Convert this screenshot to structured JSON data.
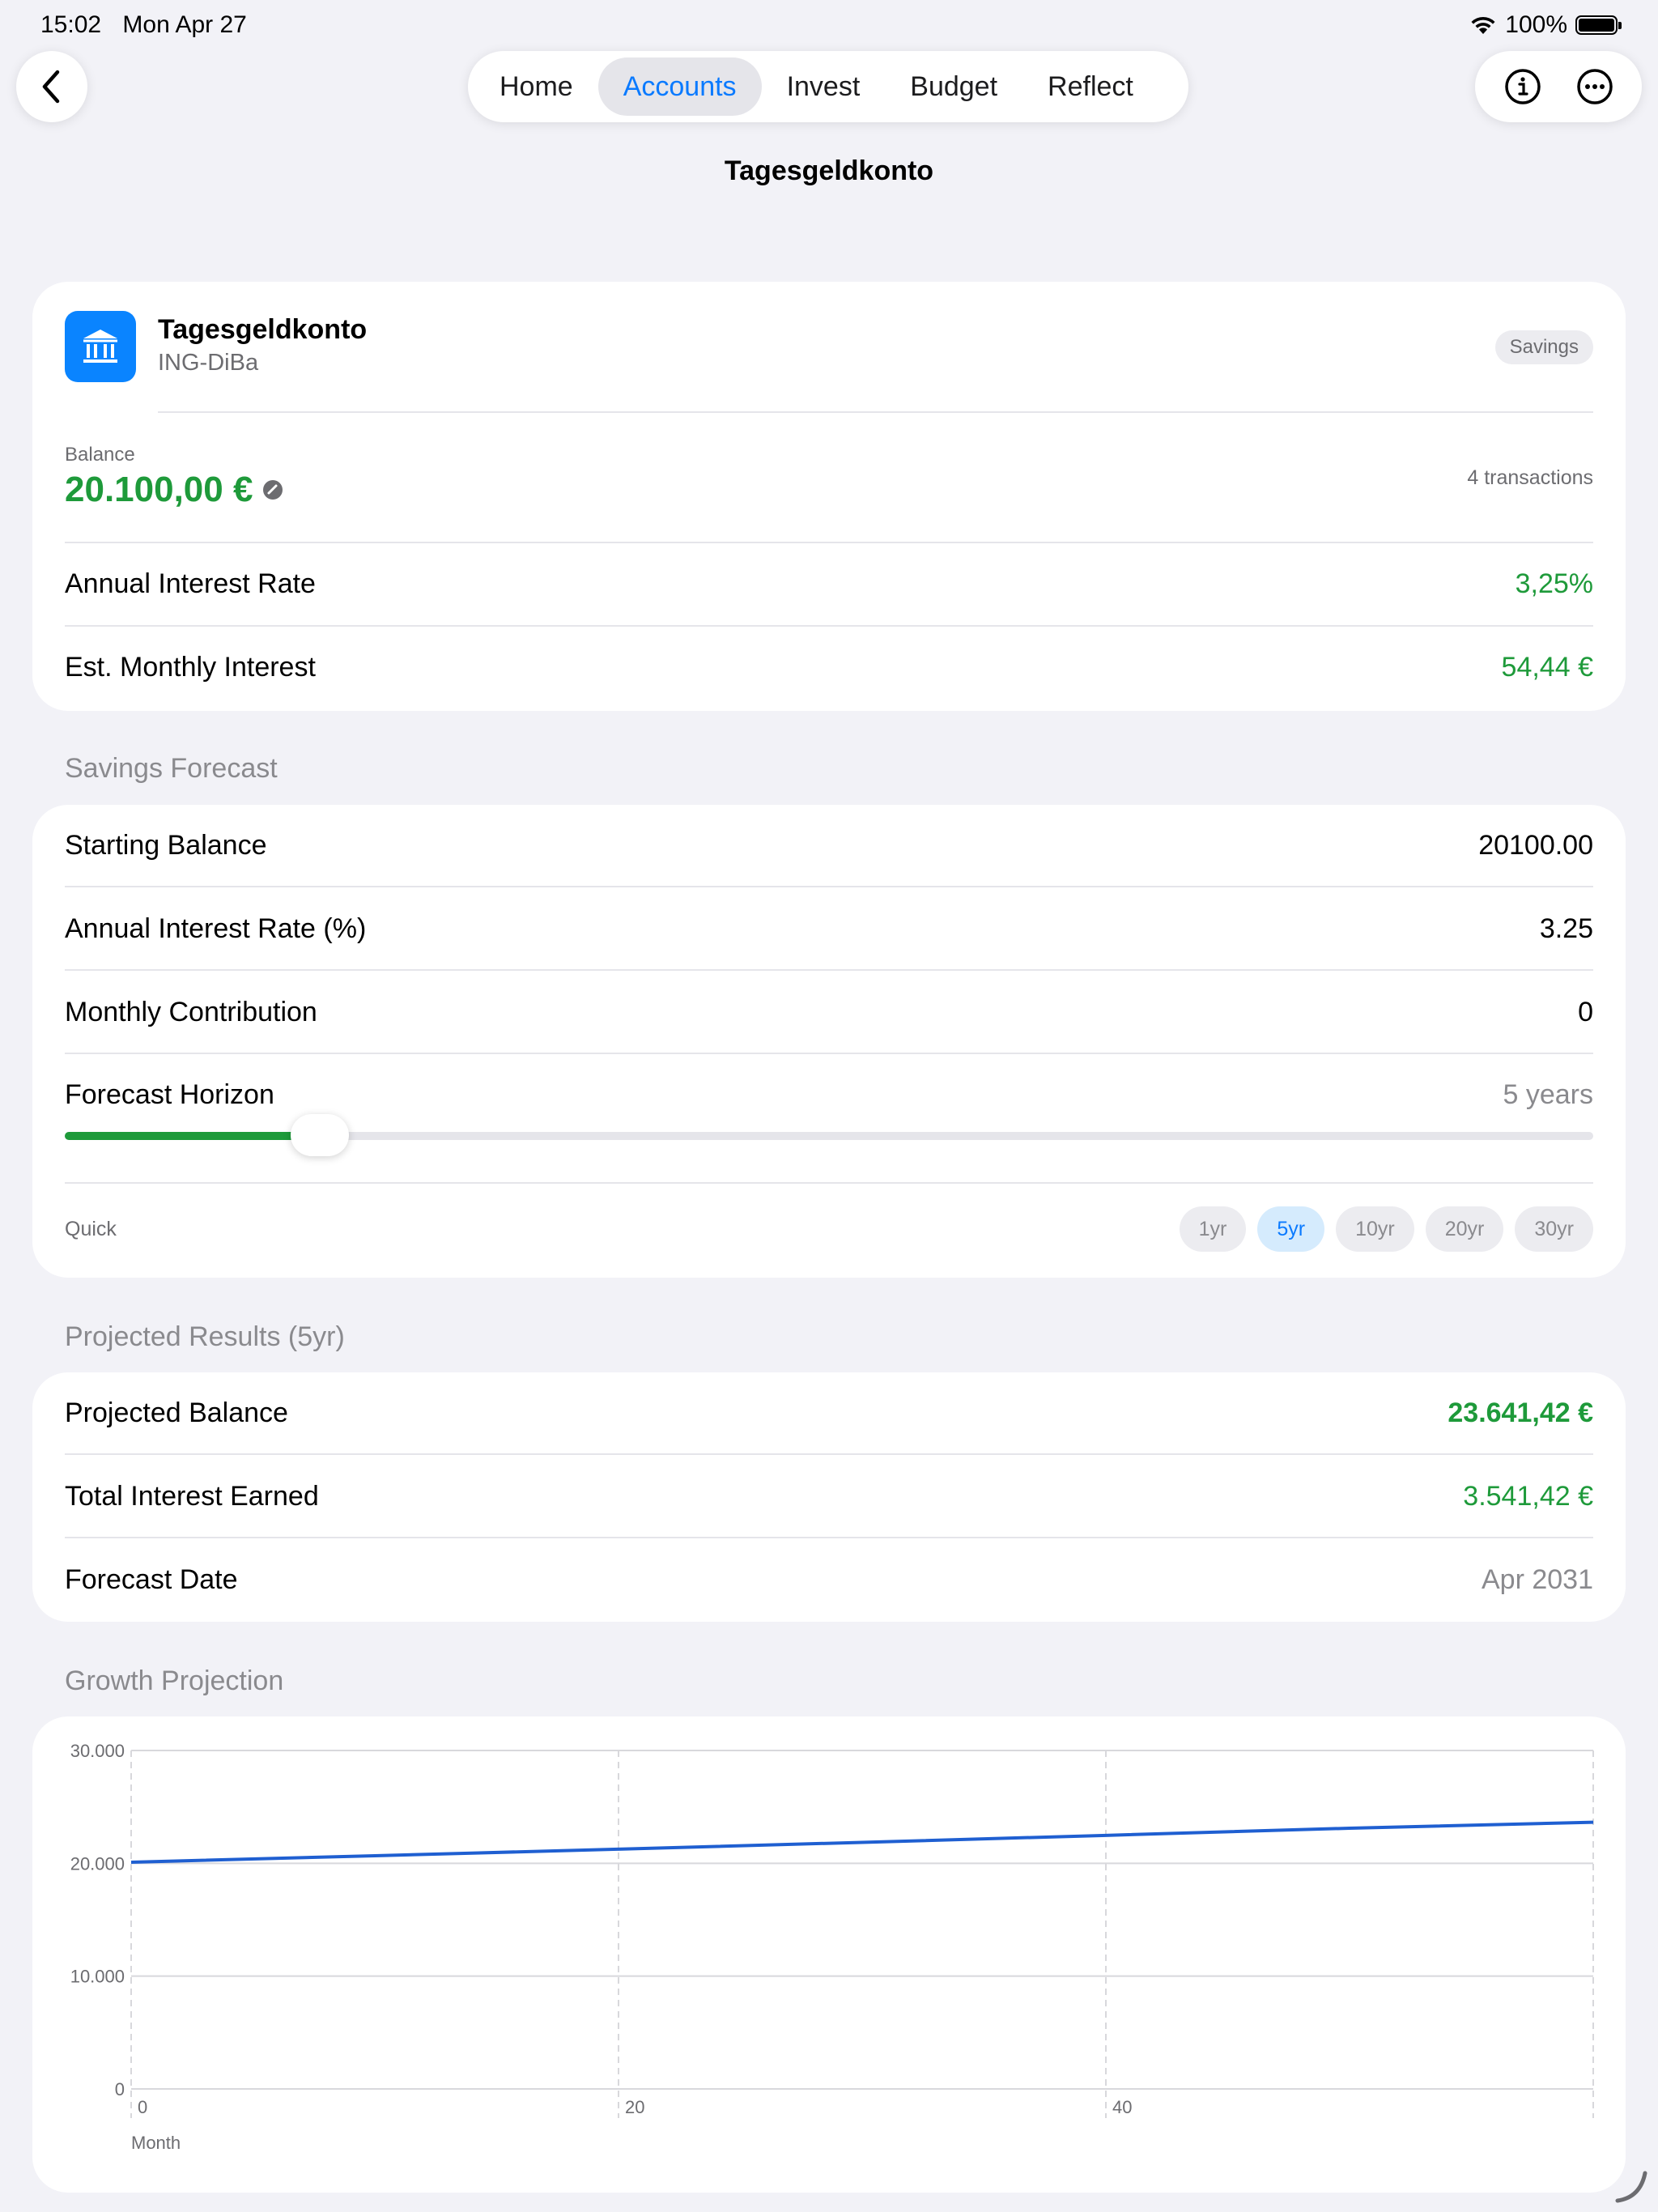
{
  "status_bar": {
    "time": "15:02",
    "date": "Mon Apr 27",
    "battery": "100%"
  },
  "nav": {
    "tabs": [
      {
        "label": "Home",
        "active": false
      },
      {
        "label": "Accounts",
        "active": true
      },
      {
        "label": "Invest",
        "active": false
      },
      {
        "label": "Budget",
        "active": false
      },
      {
        "label": "Reflect",
        "active": false
      }
    ],
    "title": "Tagesgeldkonto"
  },
  "account": {
    "name": "Tagesgeldkonto",
    "bank": "ING-DiBa",
    "type_badge": "Savings",
    "balance_label": "Balance",
    "balance": "20.100,00 €",
    "transactions": "4 transactions",
    "rows": [
      {
        "label": "Annual Interest Rate",
        "value": "3,25%"
      },
      {
        "label": "Est. Monthly Interest",
        "value": "54,44 €"
      }
    ]
  },
  "forecast": {
    "header": "Savings Forecast",
    "starting_balance_label": "Starting Balance",
    "starting_balance": "20100.00",
    "rate_label": "Annual Interest Rate (%)",
    "rate": "3.25",
    "contribution_label": "Monthly Contribution",
    "contribution": "0",
    "horizon_label": "Forecast Horizon",
    "horizon_value": "5 years",
    "horizon_years": 5,
    "horizon_max_years": 30,
    "quick_label": "Quick",
    "quick_options": [
      {
        "label": "1yr",
        "selected": false
      },
      {
        "label": "5yr",
        "selected": true
      },
      {
        "label": "10yr",
        "selected": false
      },
      {
        "label": "20yr",
        "selected": false
      },
      {
        "label": "30yr",
        "selected": false
      }
    ]
  },
  "results": {
    "header": "Projected Results (5yr)",
    "projected_balance_label": "Projected Balance",
    "projected_balance": "23.641,42 €",
    "total_interest_label": "Total Interest Earned",
    "total_interest": "3.541,42 €",
    "forecast_date_label": "Forecast Date",
    "forecast_date": "Apr 2031"
  },
  "growth": {
    "header": "Growth Projection"
  },
  "colors": {
    "accent": "#0a7aff",
    "positive": "#1e9a3a",
    "line": "#1f5fd1",
    "icon_bg": "#0a84ff"
  },
  "chart_data": {
    "type": "line",
    "xlabel": "Month",
    "ylabel": "",
    "x_ticks": [
      0,
      20,
      40
    ],
    "x_tick_labels": [
      "0",
      "20",
      "40"
    ],
    "xlim": [
      0,
      60
    ],
    "y_ticks": [
      0,
      10000,
      20000,
      30000
    ],
    "y_tick_labels": [
      "0",
      "10.000",
      "20.000",
      "30.000"
    ],
    "ylim": [
      0,
      30000
    ],
    "grid": true,
    "series": [
      {
        "x": [
          0,
          10,
          20,
          30,
          40,
          50,
          60
        ],
        "values": [
          20100,
          20670,
          21255,
          21857,
          22476,
          23112,
          23641
        ]
      }
    ]
  }
}
